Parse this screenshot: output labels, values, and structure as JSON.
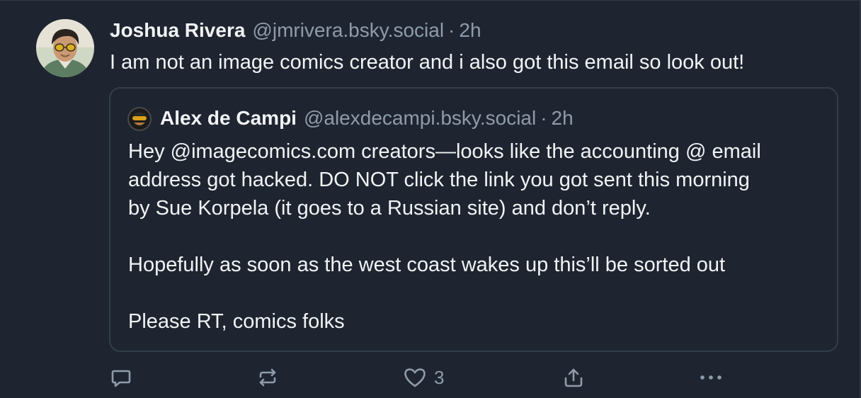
{
  "post": {
    "author": {
      "display_name": "Joshua Rivera",
      "handle": "@jmrivera.bsky.social",
      "avatar_icon": "user-avatar-photo"
    },
    "separator": "·",
    "time": "2h",
    "text": "I am not an image comics creator and i also got this email so look out!"
  },
  "quote": {
    "author": {
      "display_name": "Alex de Campi",
      "handle": "@alexdecampi.bsky.social",
      "avatar_icon": "quoted-user-avatar"
    },
    "separator": "·",
    "time": "2h",
    "paragraphs": [
      "Hey @imagecomics.com creators—looks like the accounting @ email",
      "address got hacked. DO NOT click the link you got sent this morning",
      "by Sue Korpela (it goes to a Russian site) and don’t reply.",
      "",
      "Hopefully as soon as the west coast wakes up this’ll be sorted out",
      "",
      "Please RT, comics folks"
    ]
  },
  "actions": {
    "reply_icon": "reply-icon",
    "repost_icon": "repost-icon",
    "like_icon": "heart-icon",
    "like_count": "3",
    "share_icon": "share-icon",
    "more_icon": "more-options-icon"
  },
  "colors": {
    "background": "#1e2530",
    "text_primary": "#f1f3f5",
    "text_secondary": "#8f9bab",
    "border": "#323d4c"
  }
}
